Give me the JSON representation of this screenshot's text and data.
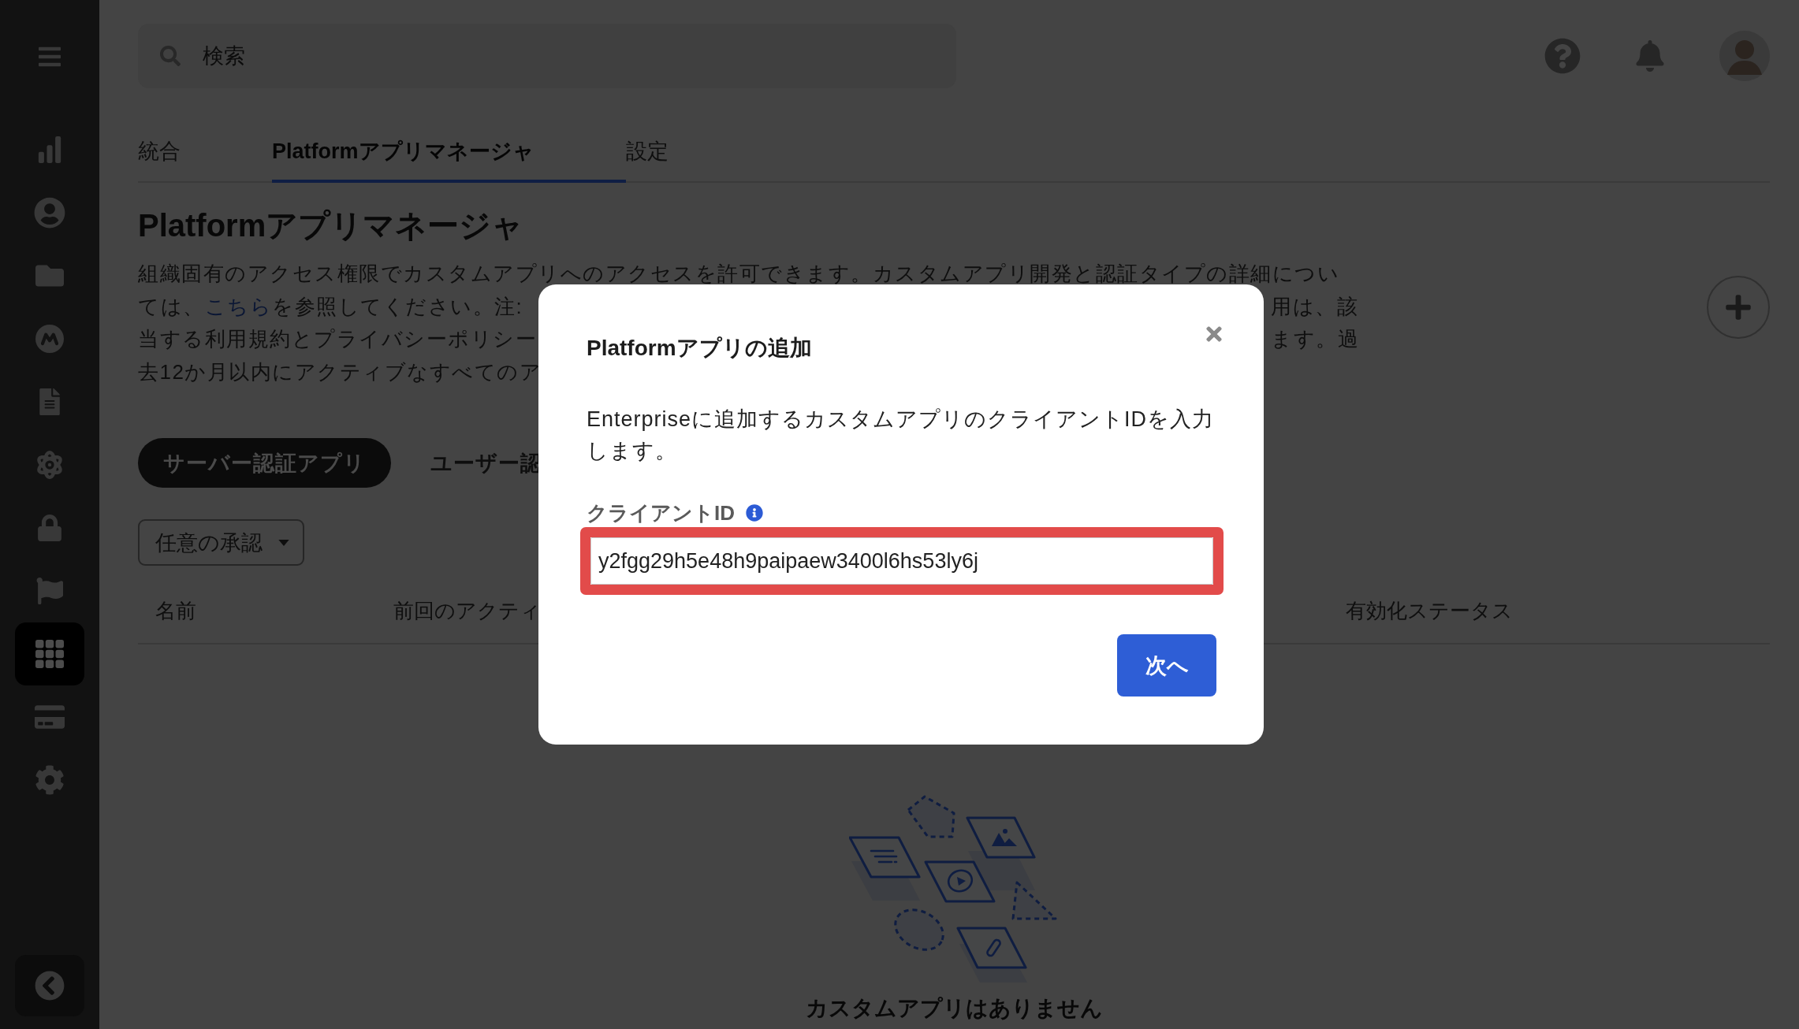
{
  "sidebar": {
    "items": [
      {
        "selected": false
      },
      {
        "selected": false
      },
      {
        "selected": false
      },
      {
        "selected": false
      },
      {
        "selected": false
      },
      {
        "selected": false
      },
      {
        "selected": false
      },
      {
        "selected": false
      },
      {
        "selected": true
      },
      {
        "selected": false
      },
      {
        "selected": false
      }
    ]
  },
  "search": {
    "placeholder": "検索"
  },
  "tabs": [
    {
      "label": "統合",
      "selected": false
    },
    {
      "label": "Platformアプリマネージャ",
      "selected": true
    },
    {
      "label": "設定",
      "selected": false
    }
  ],
  "page": {
    "title": "Platformアプリマネージャ",
    "description": [
      {
        "kind": "full",
        "left": [
          {
            "kind": "text",
            "text": "組織固有のアクセス権限でカスタムアプリへのアクセスを許可できます。カスタムアプリ開発と認証タイプの詳細につい"
          }
        ]
      },
      {
        "kind": "split",
        "left": [
          {
            "kind": "text",
            "text": "ては、"
          },
          {
            "kind": "link",
            "text": "こちら"
          },
          {
            "kind": "text",
            "text": "を参照してください。注:"
          }
        ],
        "right": "用は、該"
      },
      {
        "kind": "split",
        "left": [
          {
            "kind": "text",
            "text": "当する利用規約とプライバシーポリシー"
          }
        ],
        "right": "ます。過"
      },
      {
        "kind": "split",
        "left": [
          {
            "kind": "text",
            "text": "去12か月以内にアクティブなすべてのア"
          }
        ]
      }
    ]
  },
  "app_types": [
    {
      "label": "サーバー認証アプリ",
      "selected": true
    },
    {
      "label": "ユーザー認",
      "selected": false
    }
  ],
  "filter": {
    "label": "任意の承認"
  },
  "table": {
    "columns": [
      "名前",
      "前回のアクティ",
      "有効化ステータス"
    ]
  },
  "empty_state": {
    "title": "カスタムアプリはありません"
  },
  "dialog": {
    "title": "Platformアプリの追加",
    "description": "Enterpriseに追加するカスタムアプリのクライアントIDを入力します。",
    "field": {
      "label": "クライアントID",
      "value": "y2fgg29h5e48h9paipaew3400l6hs53ly6j",
      "highlighted": true
    },
    "primary_button": "次へ"
  }
}
